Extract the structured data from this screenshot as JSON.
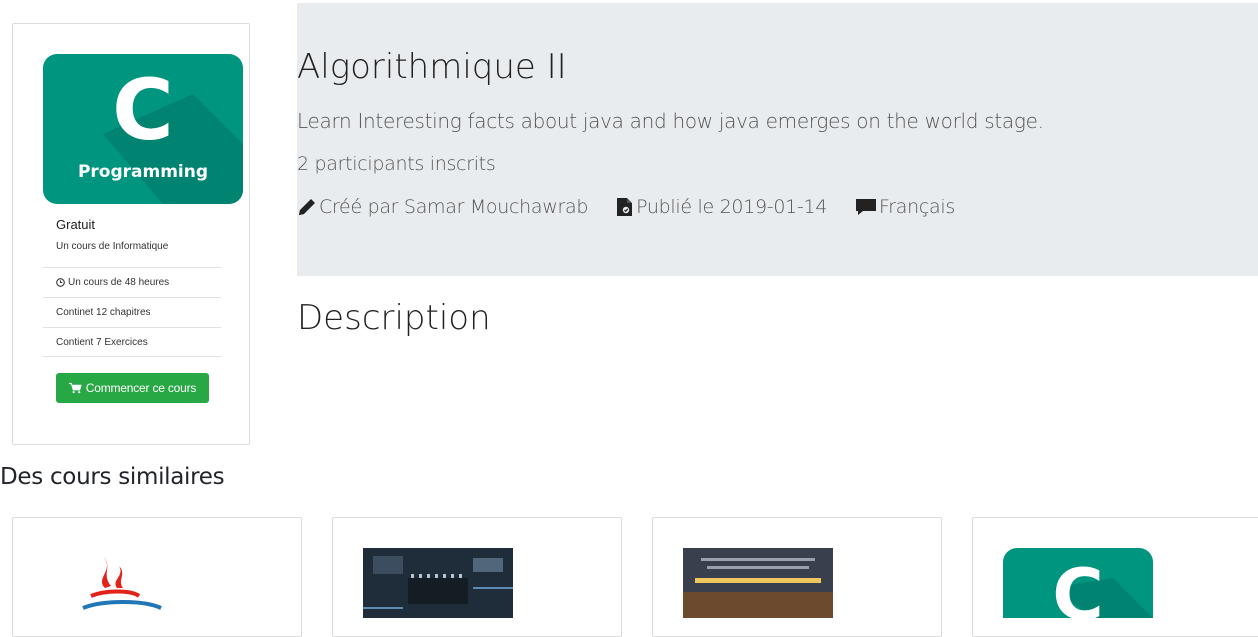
{
  "course_card": {
    "logo_letter": "C",
    "logo_caption": "Programming",
    "price": "Gratuit",
    "category": "Un cours de Informatique",
    "info": [
      "Un cours de 48 heures",
      "Continet 12 chapitres",
      "Contient 7 Exercices"
    ],
    "start_button": "Commencer ce cours"
  },
  "jumbotron": {
    "title": "Algorithmique II",
    "lead": "Learn Interesting facts about java and how java emerges on the world stage.",
    "participants": "2 participants inscrits",
    "author": "Créé par Samar Mouchawrab",
    "published": "Publié le 2019-01-14",
    "language": "Français"
  },
  "description_title": "Description",
  "similar": {
    "title": "Des cours similaires",
    "cards": [
      {
        "icon": "java-logo-icon"
      },
      {
        "icon": "circuit-board-image"
      },
      {
        "icon": "books-banner-image"
      },
      {
        "icon": "c-programming-logo",
        "logo_letter": "C"
      }
    ]
  },
  "colors": {
    "accent_teal": "#00957f",
    "button_green": "#28a745",
    "jumbotron_bg": "#e9ecef"
  }
}
